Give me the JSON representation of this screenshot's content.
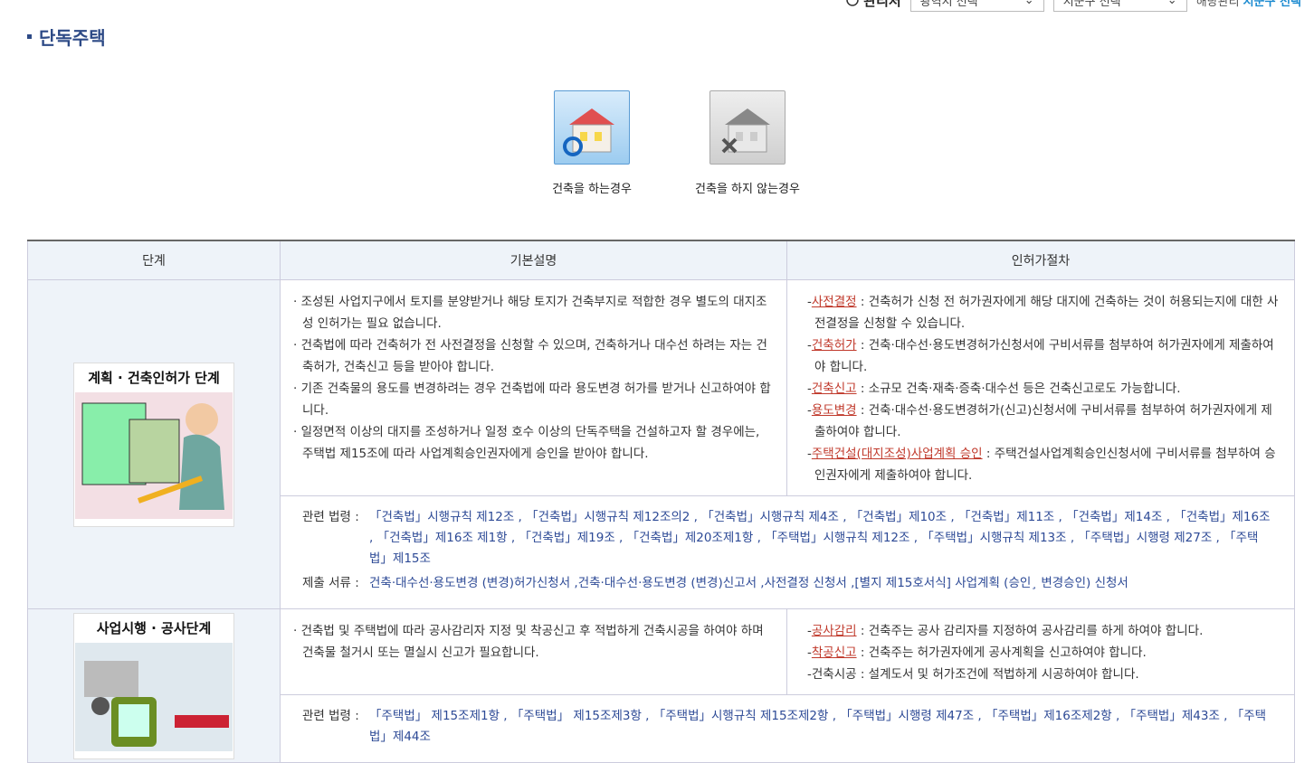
{
  "topbar": {
    "region_label": "관리처",
    "sido_select": "광역시 선택",
    "sigungu_select": "시군구 선택",
    "note_prefix": "해당관리",
    "note_highlight": "시군구 선택"
  },
  "page": {
    "title": "단독주택"
  },
  "cases": [
    {
      "label": "건축을 하는경우",
      "icon": "house-search-icon"
    },
    {
      "label": "건축을 하지 않는경우",
      "icon": "house-cancel-icon"
    }
  ],
  "table": {
    "headers": [
      "단계",
      "기본설명",
      "인허가절차"
    ],
    "stages": [
      {
        "image_caption": "계획 · 건축인허가 단계",
        "desc": [
          "조성된 사업지구에서 토지를 분양받거나 해당 토지가 건축부지로 적합한 경우 별도의 대지조성 인허가는 필요 없습니다.",
          "건축법에 따라 건축허가 전 사전결정을 신청할 수 있으며, 건축하거나 대수선 하려는 자는 건축허가, 건축신고 등을 받아야 합니다.",
          "기존 건축물의 용도를 변경하려는 경우 건축법에 따라 용도변경 허가를 받거나 신고하여야 합니다.",
          "일정면적 이상의 대지를 조성하거나 일정 호수 이상의 단독주택을 건설하고자 할 경우에는, 주택법 제15조에 따라 사업계획승인권자에게 승인을 받아야 합니다."
        ],
        "procedures": [
          {
            "name": "사전결정",
            "text": " : 건축허가 신청 전 허가권자에게 해당 대지에 건축하는 것이 허용되는지에 대한 사전결정을 신청할 수 있습니다."
          },
          {
            "name": "건축허가",
            "text": " : 건축·대수선·용도변경허가신청서에 구비서류를 첨부하여 허가권자에게 제출하여야 합니다."
          },
          {
            "name": "건축신고",
            "text": " : 소규모 건축·재축·증축·대수선 등은 건축신고로도 가능합니다."
          },
          {
            "name": "용도변경",
            "text": " : 건축·대수선·용도변경허가(신고)신청서에 구비서류를 첨부하여 허가권자에게 제출하여야 합니다."
          },
          {
            "name": "주택건설(대지조성)사업계획 승인",
            "text": " : 주택건설사업계획승인신청서에 구비서류를 첨부하여 승인권자에게 제출하여야 합니다."
          }
        ],
        "law_label": "관련 법령 :",
        "laws": "「건축법」시행규칙 제12조 , 「건축법」시행규칙 제12조의2 , 「건축법」시행규칙 제4조 , 「건축법」제10조 , 「건축법」제11조 , 「건축법」제14조 , 「건축법」제16조 , 「건축법」제16조 제1항 , 「건축법」제19조 , 「건축법」제20조제1항 , 「주택법」시행규칙 제12조 , 「주택법」시행규칙 제13조 , 「주택법」시행령 제27조 , 「주택법」제15조",
        "docs_label": "제출 서류 :",
        "docs": "건축·대수선·용도변경 (변경)허가신청서 ,건축·대수선·용도변경 (변경)신고서 ,사전결정 신청서 ,[별지 제15호서식] 사업계획 (승인¸ 변경승인) 신청서"
      },
      {
        "image_caption": "사업시행 · 공사단계",
        "desc": [
          "건축법 및 주택법에 따라 공사감리자 지정 및 착공신고 후 적법하게 건축시공을 하여야 하며 건축물 철거시 또는 멸실시 신고가 필요합니다."
        ],
        "procedures": [
          {
            "name": "공사감리",
            "text": " : 건축주는 공사 감리자를 지정하여 공사감리를 하게 하여야 합니다."
          },
          {
            "name": "착공신고",
            "text": " : 건축주는 허가권자에게 공사계획을 신고하여야 합니다."
          },
          {
            "name": "",
            "text": "건축시공 : 설계도서 및 허가조건에 적법하게 시공하여야 합니다."
          }
        ],
        "law_label": "관련 법령 :",
        "laws": "「주택법」 제15조제1항 , 「주택법」 제15조제3항 , 「주택법」시행규칙 제15조제2항 , 「주택법」시행령 제47조 , 「주택법」제16조제2항 , 「주택법」제43조 , 「주택법」제44조"
      }
    ]
  }
}
